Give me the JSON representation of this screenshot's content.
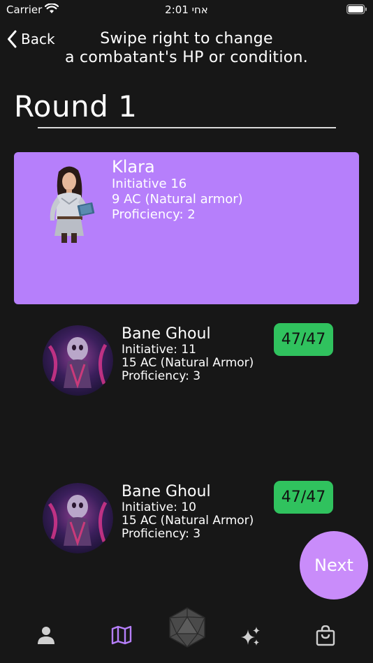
{
  "status_bar": {
    "carrier": "Carrier",
    "time": "2:01 אחי"
  },
  "header": {
    "back_label": "Back",
    "instructions_line1": "Swipe right to change",
    "instructions_line2": "a combatant's HP or condition."
  },
  "round": {
    "title": "Round 1"
  },
  "active_combatant": {
    "name": "Klara",
    "initiative": "Initiative 16",
    "armor": "9 AC (Natural armor)",
    "proficiency": "Proficiency: 2"
  },
  "combatants": [
    {
      "name": "Bane Ghoul",
      "initiative": "Initiative: 11",
      "armor": "15 AC (Natural Armor)",
      "proficiency": "Proficiency: 3",
      "hp": "47/47"
    },
    {
      "name": "Bane Ghoul",
      "initiative": "Initiative: 10",
      "armor": "15 AC (Natural Armor)",
      "proficiency": "Proficiency: 3",
      "hp": "47/47"
    }
  ],
  "next_button": {
    "label": "Next"
  },
  "tab_bar": {
    "tabs": [
      {
        "icon": "person-icon"
      },
      {
        "icon": "map-icon",
        "active": true
      },
      {
        "icon": "d20-dice-icon"
      },
      {
        "icon": "sparkles-icon"
      },
      {
        "icon": "shopping-bag-icon"
      }
    ]
  },
  "colors": {
    "background": "#171717",
    "active_card": "#b67ffb",
    "hp_badge": "#30c25e",
    "next_button": "#c98cfa",
    "active_tab": "#b67ffb",
    "inactive_tab": "#d0d0d0"
  }
}
